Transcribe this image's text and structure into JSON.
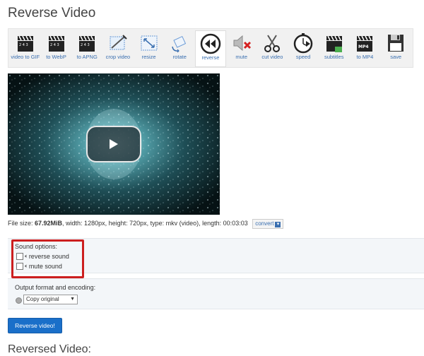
{
  "page": {
    "title": "Reverse Video",
    "reversed_title": "Reversed Video:"
  },
  "toolbar": {
    "items": [
      {
        "label": "video to GIF",
        "icon": "clapperboard-icon"
      },
      {
        "label": "to WebP",
        "icon": "clapperboard-icon"
      },
      {
        "label": "to APNG",
        "icon": "clapperboard-icon"
      },
      {
        "label": "crop video",
        "icon": "crop-icon"
      },
      {
        "label": "resize",
        "icon": "resize-icon"
      },
      {
        "label": "rotate",
        "icon": "rotate-icon"
      },
      {
        "label": "reverse",
        "icon": "rewind-icon",
        "active": true
      },
      {
        "label": "mute",
        "icon": "mute-icon"
      },
      {
        "label": "cut video",
        "icon": "scissors-icon"
      },
      {
        "label": "speed",
        "icon": "stopwatch-icon"
      },
      {
        "label": "subtitles",
        "icon": "clapperboard-icon"
      },
      {
        "label": "to MP4",
        "icon": "clapperboard-icon"
      },
      {
        "label": "save",
        "icon": "floppy-disk-icon"
      }
    ]
  },
  "file_info": {
    "prefix": "File size: ",
    "size": "67.92MiB",
    "details": ", width: 1280px, height: 720px, type: mkv (video), length: 00:03:03",
    "convert_label": "convert"
  },
  "sound_options": {
    "title": "Sound options:",
    "reverse_label": "reverse sound",
    "mute_label": "mute sound"
  },
  "output": {
    "title": "Output format and encoding:",
    "selected": "Copy original"
  },
  "actions": {
    "reverse_button": "Reverse video!"
  },
  "colors": {
    "accent": "#1a6fc9",
    "highlight": "#cc1f1f"
  }
}
